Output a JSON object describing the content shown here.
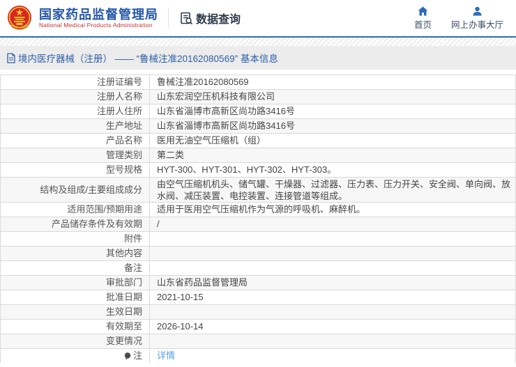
{
  "header": {
    "agency_cn": "国家药品监督管理局",
    "agency_en": "National Medical Products Administration",
    "section_title": "数据查询",
    "nav": [
      {
        "label": "首页",
        "icon": "home-icon"
      },
      {
        "label": "网上办事大厅",
        "icon": "person-icon"
      }
    ]
  },
  "breadcrumb": {
    "text": "境内医疗器械（注册） —— “鲁械注准20162080569” 基本信息"
  },
  "table": {
    "rows": [
      {
        "label": "注册证编号",
        "value": "鲁械注准20162080569"
      },
      {
        "label": "注册人名称",
        "value": "山东宏润空压机科技有限公司"
      },
      {
        "label": "注册人住所",
        "value": "山东省淄博市高新区尚功路3416号"
      },
      {
        "label": "生产地址",
        "value": "山东省淄博市高新区尚功路3416号"
      },
      {
        "label": "产品名称",
        "value": "医用无油空气压缩机（组）"
      },
      {
        "label": "管理类别",
        "value": "第二类"
      },
      {
        "label": "型号规格",
        "value": "HYT-300、HYT-301、HYT-302、HYT-303。"
      },
      {
        "label": "结构及组成/主要组成成分",
        "value": "由空气压缩机机头、储气罐、干燥器、过滤器、压力表、压力开关、安全阀、单向阀、放水阀、减压装置、电控装置、连接管道等组成。"
      },
      {
        "label": "适用范围/预期用途",
        "value": "适用于医用空气压缩机作为气源的呼吸机、麻醉机。"
      },
      {
        "label": "产品储存条件及有效期",
        "value": "/"
      },
      {
        "label": "附件",
        "value": ""
      },
      {
        "label": "其他内容",
        "value": ""
      },
      {
        "label": "备注",
        "value": ""
      },
      {
        "label": "审批部门",
        "value": "山东省药品监督管理局"
      },
      {
        "label": "批准日期",
        "value": "2021-10-15"
      },
      {
        "label": "生效日期",
        "value": ""
      },
      {
        "label": "有效期至",
        "value": "2026-10-14"
      },
      {
        "label": "变更情况",
        "value": ""
      },
      {
        "label": "注",
        "value": "详情",
        "value_is_link": true,
        "icon": "comment-icon"
      }
    ]
  },
  "colors": {
    "brand_blue": "#2457a6",
    "brand_red": "#c62f2f",
    "header_rule_blue": "#2a6ebb",
    "titlebar_bg": "#ececec",
    "breadcrumb_blue": "#2d5fa8",
    "row_alt_bg": "#f7f7f7",
    "table_border": "#d9d9d9",
    "link_blue": "#58a0e3",
    "nav_icon_blue": "#2b6cb8"
  }
}
